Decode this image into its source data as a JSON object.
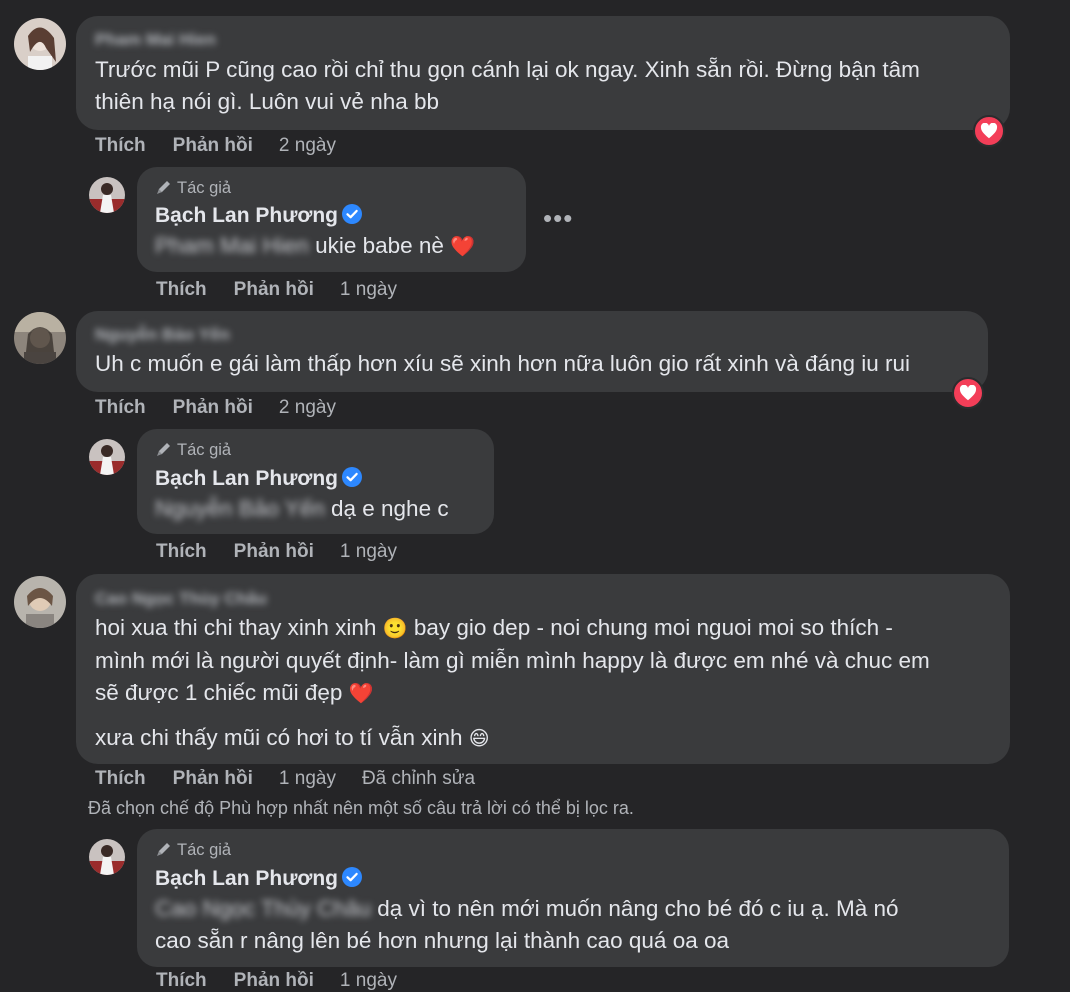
{
  "actions": {
    "like": "Thích",
    "reply": "Phản hồi"
  },
  "author": {
    "tag": "Tác giả",
    "name": "Bạch Lan Phương"
  },
  "comment1": {
    "name": "Pham Mai Hien",
    "text_line1": "Trước mũi P cũng cao rồi chỉ thu gọn cánh lại ok ngay. Xinh sẵn rồi. Đừng bận tâm",
    "text_line2": "thiên hạ nói gì. Luôn vui vẻ nha bb",
    "time": "2 ngày",
    "reaction": "love"
  },
  "reply1": {
    "mention": "Pham Mai Hien",
    "text": "ukie babe nè",
    "emoji": "❤️",
    "time": "1 ngày"
  },
  "comment2": {
    "name": "Nguyễn Bảo Yến",
    "text": "Uh c muốn e gái làm thấp hơn xíu sẽ xinh hơn nữa luôn gio rất xinh và đáng iu rui",
    "time": "2 ngày",
    "reaction": "love"
  },
  "reply2": {
    "mention": "Nguyễn Bảo Yến",
    "text": "dạ e nghe c",
    "time": "1 ngày"
  },
  "comment3": {
    "name": "Cao Ngọc Thùy Châu",
    "para1_line1a": "hoi xua thi chi thay xinh xinh",
    "para1_line1b": "bay gio dep - noi chung moi nguoi moi so thích -",
    "para1_line2": "mình mới là người quyết định- làm gì miễn mình happy là được em nhé và chuc em",
    "para1_line3": "sẽ được 1 chiếc mũi đẹp",
    "para2": "xưa chi thấy mũi có hơi to tí vẫn xinh",
    "emoji_smile": "🙂",
    "emoji_heart": "❤️",
    "emoji_grin": "😄",
    "time": "1 ngày",
    "edited": "Đã chỉnh sửa"
  },
  "filter_note": "Đã chọn chế độ Phù hợp nhất nên một số câu trả lời có thể bị lọc ra.",
  "reply3": {
    "mention": "Cao Ngọc Thùy Châu",
    "text_line1": "dạ vì to nên mới muốn nâng cho bé đó c iu ạ. Mà nó",
    "text_line2": "cao sẵn r nâng lên bé hơn nhưng lại thành cao quá oa oa",
    "time": "1 ngày"
  },
  "more_menu": "•••",
  "colors": {
    "bg": "#252527",
    "bubble": "#3a3b3d",
    "love": "#f33e58",
    "verified": "#2d88ff"
  }
}
